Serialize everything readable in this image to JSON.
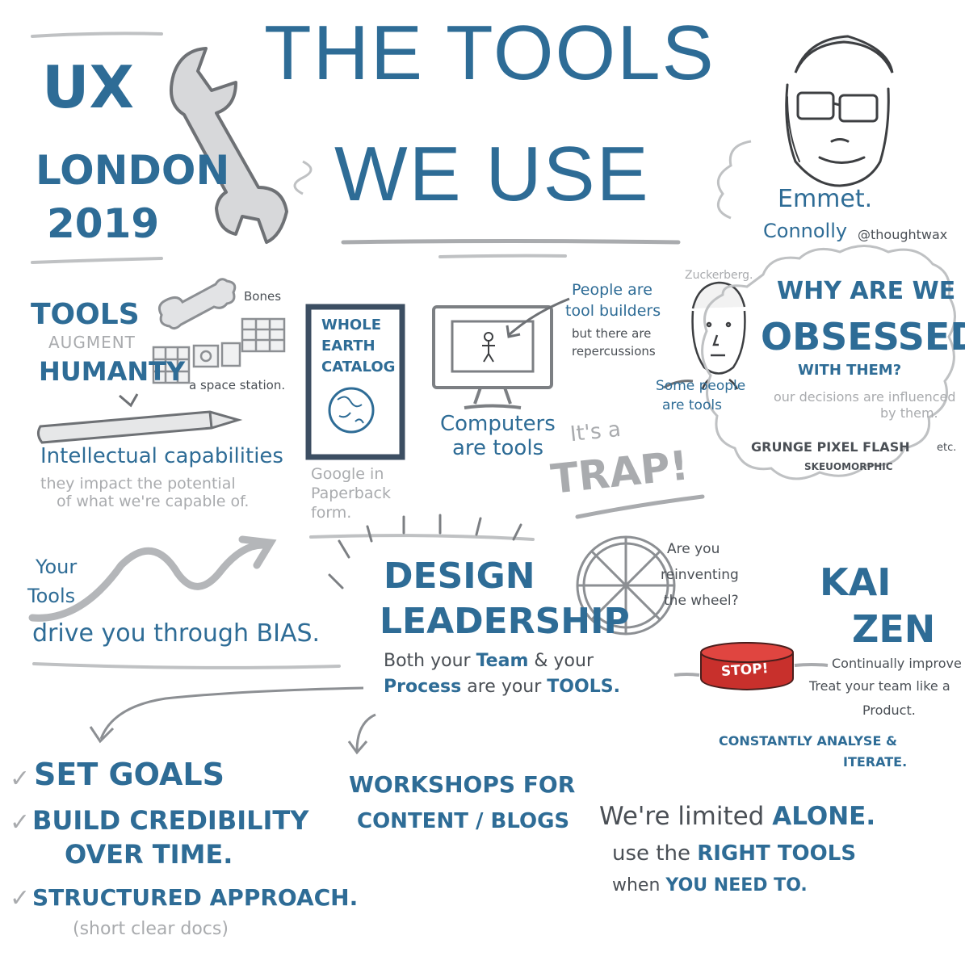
{
  "header": {
    "title_line1": "THE TOOLS",
    "title_line2": "WE USE",
    "event_line1": "UX",
    "event_line2": "LONDON",
    "event_line3": "2019"
  },
  "speaker": {
    "first_name": "Emmet.",
    "last_name": "Connolly",
    "handle": "@thoughtwax"
  },
  "tools_section": {
    "title": "TOOLS",
    "augment": "AUGMENT",
    "humanity": "HUMANTY",
    "bones": "Bones",
    "space_station": "a space station.",
    "intellectual": "Intellectual capabilities",
    "impact_line1": "they impact the potential",
    "impact_line2": "of what we're capable of."
  },
  "catalog": {
    "line1": "WHOLE",
    "line2": "EARTH",
    "line3": "CATALOG",
    "caption_line1": "Google in",
    "caption_line2": "Paperback",
    "caption_line3": "form."
  },
  "computers": {
    "label_line1": "Computers",
    "label_line2": "are tools",
    "builders_line1": "People are",
    "builders_line2": "tool builders",
    "builders_line3": "but there are",
    "builders_line4": "repercussions"
  },
  "people": {
    "name": "Zuckerberg.",
    "label_line1": "Some people",
    "label_line2": "are tools"
  },
  "obsessed": {
    "line1": "WHY ARE WE",
    "line2": "OBSESSED",
    "line3": "WITH THEM?",
    "sub_line1": "our decisions are influenced",
    "sub_line2": "by them.",
    "styles_line1": "GRUNGE  PIXEL  FLASH",
    "styles_etc": "etc.",
    "styles_line2": "SKEUOMORPHIC"
  },
  "trap": {
    "line1": "It's a",
    "line2": "TRAP!"
  },
  "bias": {
    "your": "Your",
    "tools": "Tools",
    "drive": "drive you through BIAS."
  },
  "leadership": {
    "line1": "DESIGN",
    "line2": "LEADERSHIP",
    "sub_line1_a": "Both your",
    "sub_line1_b": "Team",
    "sub_line1_c": "& your",
    "sub_line2_a": "Process",
    "sub_line2_b": "are your",
    "sub_line2_c": "TOOLS."
  },
  "wheel": {
    "line1": "Are you",
    "line2": "reinventing",
    "line3": "the wheel?"
  },
  "kaizen": {
    "line1": "KAI",
    "line2": "ZEN",
    "stop": "STOP!",
    "improve": "Continually improve",
    "treat": "Treat your team like a",
    "product": "Product.",
    "analyse_line1": "CONSTANTLY ANALYSE &",
    "analyse_line2": "ITERATE."
  },
  "goals": {
    "check": "✓",
    "item1": "SET GOALS",
    "item2_line1": "BUILD CREDIBILITY",
    "item2_line2": "OVER TIME.",
    "item3": "STRUCTURED APPROACH.",
    "item3_note": "(short clear docs)"
  },
  "workshops": {
    "line1": "WORKSHOPS FOR",
    "line2": "CONTENT / BLOGS"
  },
  "alone": {
    "line1_a": "We're limited",
    "line1_b": "ALONE.",
    "line2_a": "use the",
    "line2_b": "RIGHT TOOLS",
    "line3_a": "when",
    "line3_b": "YOU NEED TO."
  },
  "colors": {
    "accent_blue": "#2e6c96",
    "sketch_grey": "#a9abae",
    "stop_red": "#c8302c"
  }
}
